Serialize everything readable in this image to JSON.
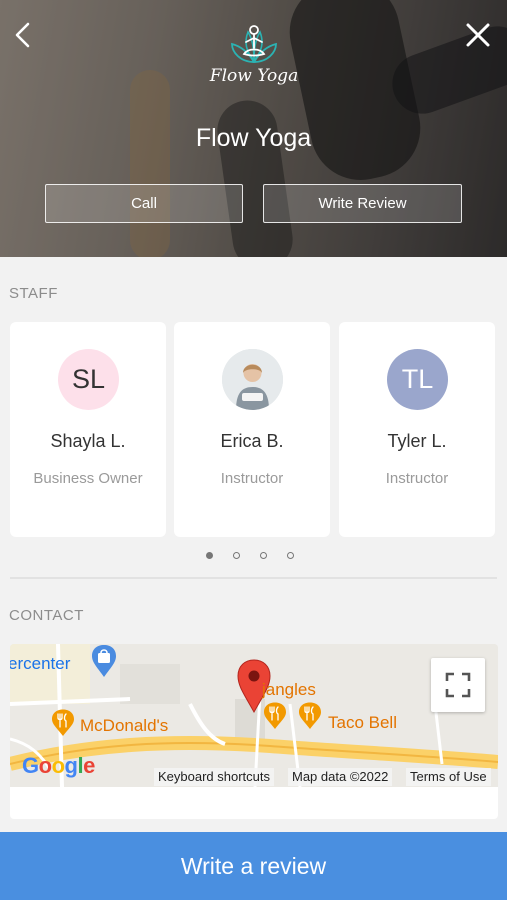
{
  "header": {
    "logo_text": "Flow Yoga",
    "studio_name": "Flow Yoga",
    "call_label": "Call",
    "write_review_label": "Write Review"
  },
  "staff": {
    "title": "STAFF",
    "members": [
      {
        "initials": "SL",
        "name": "Shayla L.",
        "role": "Business Owner",
        "avatar_bg": "#fde0ea"
      },
      {
        "initials": "",
        "name": "Erica B.",
        "role": "Instructor",
        "avatar_bg": "#dfe4e6"
      },
      {
        "initials": "TL",
        "name": "Tyler L.",
        "role": "Instructor",
        "avatar_bg": "#9aa6cc"
      }
    ],
    "page_count": 4,
    "active_page": 1
  },
  "contact": {
    "title": "CONTACT",
    "map": {
      "labels": {
        "center": "ercenter",
        "mcdonalds": "McDonald's",
        "bojangles": "jangles",
        "tacobell": "Taco Bell"
      },
      "google": "Google",
      "keyboard_shortcuts": "Keyboard shortcuts",
      "map_data": "Map data ©2022",
      "terms": "Terms of Use"
    }
  },
  "cta": {
    "label": "Write a review"
  },
  "colors": {
    "accent": "#4a8fe0",
    "map_pin": "#ea4335",
    "food_label": "#e37400"
  }
}
